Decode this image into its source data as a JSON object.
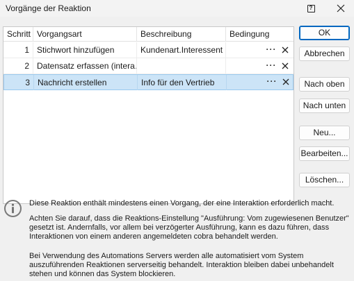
{
  "window": {
    "title": "Vorgänge der Reaktion"
  },
  "grid": {
    "columns": [
      "Schritt",
      "Vorgangsart",
      "Beschreibung",
      "Bedingung"
    ],
    "rows": [
      {
        "step": "1",
        "type": "Stichwort hinzufügen",
        "description": "Kundenart.Interessent",
        "condition": "",
        "selected": false
      },
      {
        "step": "2",
        "type": "Datensatz erfassen (intera…",
        "description": "",
        "condition": "",
        "selected": false
      },
      {
        "step": "3",
        "type": "Nachricht erstellen",
        "description": "Info für den Vertrieb",
        "condition": "",
        "selected": true
      }
    ],
    "row_menu_label": "···"
  },
  "buttons": {
    "ok": "OK",
    "cancel": "Abbrechen",
    "move_up": "Nach oben",
    "move_down": "Nach unten",
    "new": "Neu...",
    "edit": "Bearbeiten...",
    "delete": "Löschen..."
  },
  "info": {
    "line1": "Diese Reaktion enthält mindestens einen Vorgang, der eine Interaktion erforderlich macht.",
    "line2": "Achten Sie darauf, dass die Reaktions-Einstellung \"Ausführung: Vom zugewiesenen Benutzer\" gesetzt ist. Andernfalls, vor allem bei verzögerter Ausführung, kann es dazu führen, dass Interaktionen von einem anderen angemeldeten cobra behandelt werden.",
    "line3": "Bei Verwendung des Automations Servers werden alle automatisiert vom System auszuführenden Reaktionen serverseitig behandelt. Interaktion bleiben dabei unbehandelt stehen und können das System blockieren."
  },
  "icons": {
    "help": "help-icon",
    "close": "close-icon",
    "info": "info-icon",
    "row_delete": "delete-x-icon",
    "row_menu": "more-icon"
  }
}
